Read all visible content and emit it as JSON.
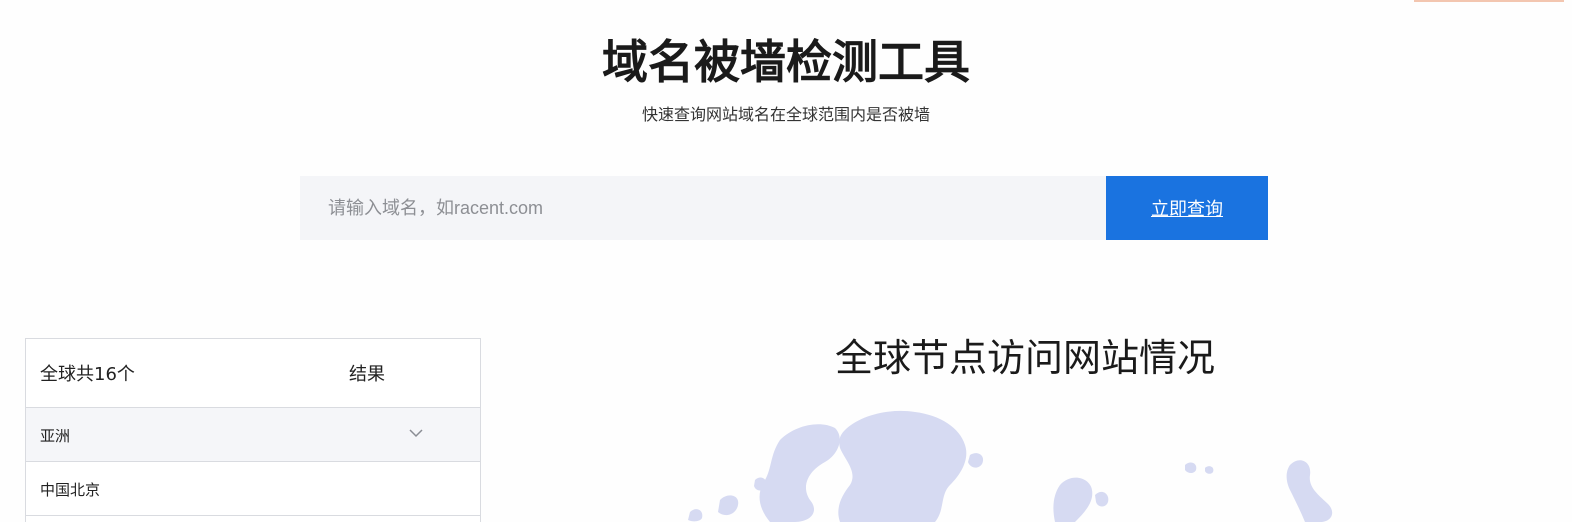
{
  "header": {
    "title": "域名被墙检测工具",
    "subtitle": "快速查询网站域名在全球范围内是否被墙"
  },
  "search": {
    "placeholder": "请输入域名，如racent.com",
    "value": "",
    "button_label": "立即查询"
  },
  "results": {
    "total_label": "全球共16个",
    "result_column": "结果",
    "region": "亚洲",
    "locations": [
      "中国北京"
    ]
  },
  "map": {
    "title": "全球节点访问网站情况",
    "land_color": "#d6daf2"
  },
  "colors": {
    "accent": "#1a73e0",
    "input_bg": "#f4f5f8",
    "border": "#d9dbe0"
  }
}
